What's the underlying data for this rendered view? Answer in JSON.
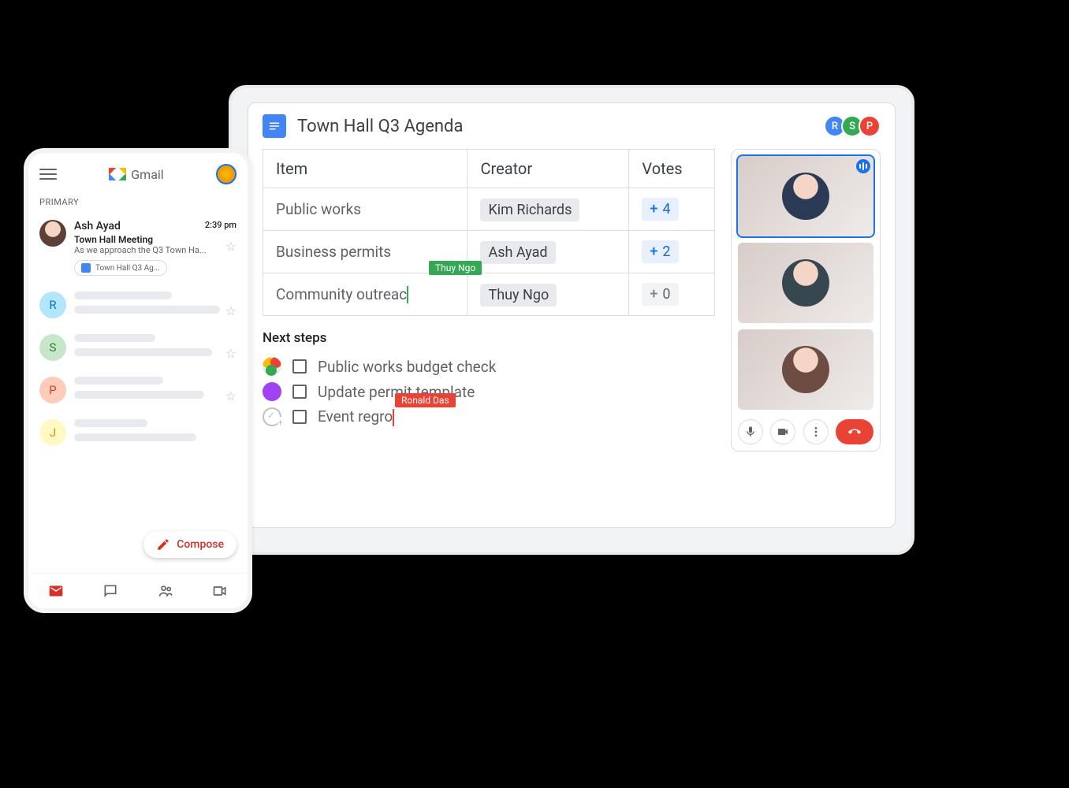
{
  "docs": {
    "title": "Town Hall Q3 Agenda",
    "collaborators": [
      {
        "initial": "R",
        "color": "blue"
      },
      {
        "initial": "S",
        "color": "green"
      },
      {
        "initial": "P",
        "color": "red"
      }
    ],
    "table": {
      "headers": {
        "item": "Item",
        "creator": "Creator",
        "votes": "Votes"
      },
      "rows": [
        {
          "item": "Public works",
          "creator": "Kim Richards",
          "votes": 4
        },
        {
          "item": "Business permits",
          "creator": "Ash Ayad",
          "votes": 2
        },
        {
          "item": "Community outreac",
          "creator": "Thuy Ngo",
          "votes": 0,
          "live_cursor": "Thuy Ngo"
        }
      ]
    },
    "next_steps": {
      "title": "Next steps",
      "items": [
        {
          "label": "Public works budget check",
          "assignee_type": "multi"
        },
        {
          "label": "Update permit template",
          "assignee_type": "single"
        },
        {
          "label": "Event regro",
          "assignee_type": "unassigned",
          "live_cursor": "Ronald Das"
        }
      ]
    }
  },
  "meet": {
    "participant_count": 3,
    "active_speaker_index": 0,
    "controls": {
      "mic": "unmuted",
      "cam": "on"
    }
  },
  "gmail": {
    "brand": "Gmail",
    "tab": "PRIMARY",
    "compose_label": "Compose",
    "message": {
      "sender": "Ash Ayad",
      "time": "2:39 pm",
      "subject": "Town Hall Meeting",
      "snippet": "As we approach the Q3 Town Ha...",
      "attachment": "Town Hall Q3 Ag..."
    },
    "placeholder_initials": [
      "R",
      "S",
      "P",
      "J"
    ]
  }
}
